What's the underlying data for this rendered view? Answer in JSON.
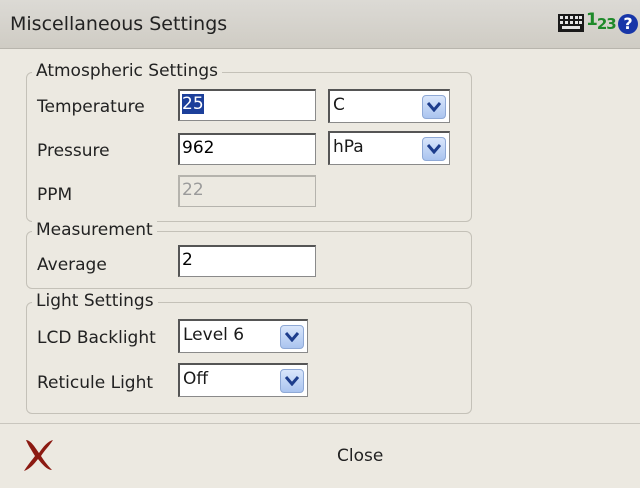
{
  "window": {
    "title": "Miscellaneous Settings"
  },
  "titlebar_icons": {
    "keyboard": "keyboard-icon",
    "input_mode": "123",
    "input_mode_digits": [
      "1",
      "2",
      "3"
    ],
    "help": "?"
  },
  "atmospheric": {
    "title": "Atmospheric Settings",
    "temperature": {
      "label": "Temperature",
      "value": "25",
      "unit": "C"
    },
    "pressure": {
      "label": "Pressure",
      "value": "962",
      "unit": "hPa"
    },
    "ppm": {
      "label": "PPM",
      "value": "22"
    }
  },
  "measurement": {
    "title": "Measurement",
    "average": {
      "label": "Average",
      "value": "2"
    }
  },
  "light": {
    "title": "Light Settings",
    "lcd_backlight": {
      "label": "LCD Backlight",
      "value": "Level 6"
    },
    "reticule_light": {
      "label": "Reticule Light",
      "value": "Off"
    }
  },
  "bottombar": {
    "close_label": "Close"
  },
  "colors": {
    "accent_red": "#e8114a",
    "close_x": "#8b1a12",
    "selection": "#1c3f9a"
  }
}
